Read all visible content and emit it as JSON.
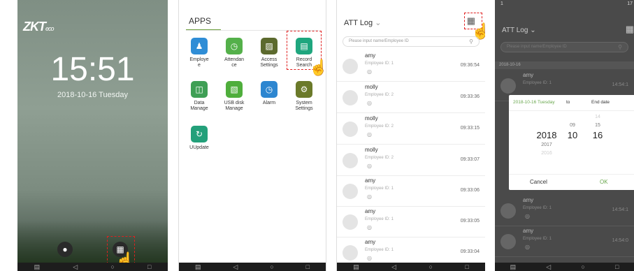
{
  "lock": {
    "logo": "ZKT",
    "logo_suffix": "eco",
    "time": "15:51",
    "date": "2018-10-16  Tuesday"
  },
  "apps": {
    "tab_label": "APPS",
    "items": [
      {
        "label": "Employe\ne",
        "icon": "users-icon",
        "color": "#2f8dd6"
      },
      {
        "label": "Attendan\nce",
        "icon": "clock-icon",
        "color": "#54b04a"
      },
      {
        "label": "Access\nSettings",
        "icon": "lock-icon",
        "color": "#5c6a2e"
      },
      {
        "label": "Record\nSearch",
        "icon": "document-icon",
        "color": "#1fa67e"
      },
      {
        "label": "Data\nManage",
        "icon": "database-icon",
        "color": "#3f9f55"
      },
      {
        "label": "USB disk\nManage",
        "icon": "usb-icon",
        "color": "#4fae3c"
      },
      {
        "label": "Alarm",
        "icon": "alarm-icon",
        "color": "#2d86d0"
      },
      {
        "label": "System\nSettings",
        "icon": "gear-icon",
        "color": "#6b7a2a"
      },
      {
        "label": "UUpdate",
        "icon": "update-icon",
        "color": "#23a07a"
      }
    ]
  },
  "attlog": {
    "title": "ATT Log",
    "search_placeholder": "Please input name/Employee ID",
    "records": [
      {
        "name": "amy",
        "id": "Employee ID: 1",
        "time": "09:36:54"
      },
      {
        "name": "molly",
        "id": "Employee ID: 2",
        "time": "09:33:36"
      },
      {
        "name": "molly",
        "id": "Employee ID: 2",
        "time": "09:33:15"
      },
      {
        "name": "molly",
        "id": "Employee ID: 2",
        "time": "09:33:07"
      },
      {
        "name": "amy",
        "id": "Employee ID: 1",
        "time": "09:33:06"
      },
      {
        "name": "amy",
        "id": "Employee ID: 1",
        "time": "09:33:05"
      },
      {
        "name": "amy",
        "id": "Employee ID: 1",
        "time": "09:33:04"
      }
    ]
  },
  "picker": {
    "status_left": "1",
    "status_right": "17",
    "title": "ATT Log",
    "search_placeholder": "Please input name/Employee ID",
    "date_band": "2018-10-16",
    "records": [
      {
        "name": "amy",
        "id": "Employee ID: 1",
        "time": "14:54:1"
      },
      {
        "name": "amy",
        "id": "Employee ID: 1",
        "time": "14:54:1"
      },
      {
        "name": "amy",
        "id": "Employee ID: 1",
        "time": "14:54:0"
      }
    ],
    "start_label": "2018-10-16 Tuesday",
    "to_label": "to",
    "end_label": "End date",
    "year_wheel": [
      "2018",
      "2017",
      "2016"
    ],
    "month_wheel": [
      "09",
      "10"
    ],
    "day_wheel": [
      "14",
      "15",
      "16"
    ],
    "cancel": "Cancel",
    "ok": "OK"
  }
}
